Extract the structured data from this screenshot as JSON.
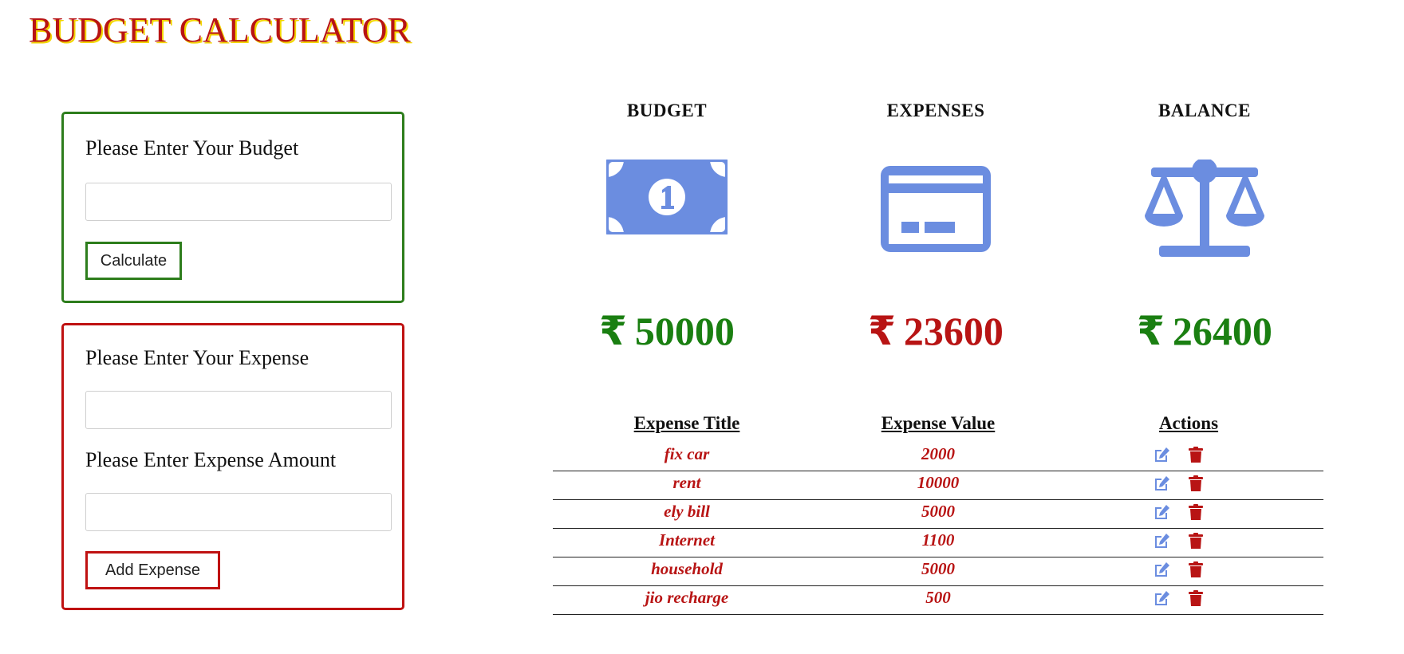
{
  "app": {
    "title": "BUDGET CALCULATOR"
  },
  "budget_form": {
    "label": "Please Enter Your Budget",
    "input_value": "",
    "button_label": "Calculate"
  },
  "expense_form": {
    "title_label": "Please Enter Your Expense",
    "title_value": "",
    "amount_label": "Please Enter Expense Amount",
    "amount_value": "",
    "button_label": "Add Expense"
  },
  "summary": {
    "currency_symbol": "₹",
    "budget": {
      "heading": "BUDGET",
      "amount": "50000",
      "icon": "money-bill-icon"
    },
    "expenses": {
      "heading": "EXPENSES",
      "amount": "23600",
      "icon": "credit-card-icon"
    },
    "balance": {
      "heading": "BALANCE",
      "amount": "26400",
      "icon": "balance-scale-icon"
    }
  },
  "table": {
    "headers": [
      "Expense Title",
      "Expense Value",
      "Actions"
    ],
    "rows": [
      {
        "title": "fix car",
        "value": "2000"
      },
      {
        "title": "rent",
        "value": "10000"
      },
      {
        "title": "ely bill",
        "value": "5000"
      },
      {
        "title": "Internet",
        "value": "1100"
      },
      {
        "title": "household",
        "value": "5000"
      },
      {
        "title": "jio recharge",
        "value": "500"
      }
    ],
    "actions": [
      "edit-icon",
      "trash-icon"
    ]
  },
  "colors": {
    "accent_green": "#1a7f11",
    "accent_red": "#b81414",
    "icon_blue": "#6b8de0",
    "title_shadow": "#f2d600"
  }
}
